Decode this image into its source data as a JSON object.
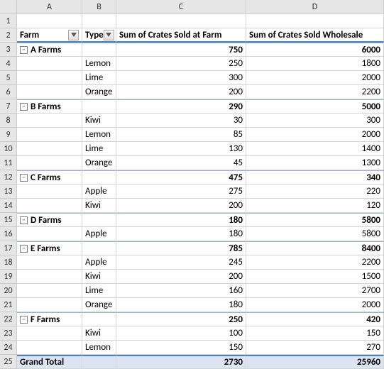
{
  "columns": [
    "A",
    "B",
    "C",
    "D"
  ],
  "headers": {
    "farm": "Farm",
    "type": "Type",
    "col_c": "Sum of Crates Sold at Farm",
    "col_d": "Sum of Crates Sold Wholesale"
  },
  "collapse_glyph": "−",
  "groups": [
    {
      "farm": "A Farms",
      "sum_c": "750",
      "sum_d": "6000",
      "rows": [
        {
          "type": "Lemon",
          "c": "250",
          "d": "1800"
        },
        {
          "type": "Lime",
          "c": "300",
          "d": "2000"
        },
        {
          "type": "Orange",
          "c": "200",
          "d": "2200"
        }
      ]
    },
    {
      "farm": "B Farms",
      "sum_c": "290",
      "sum_d": "5000",
      "rows": [
        {
          "type": "Kiwi",
          "c": "30",
          "d": "300"
        },
        {
          "type": "Lemon",
          "c": "85",
          "d": "2000"
        },
        {
          "type": "Lime",
          "c": "130",
          "d": "1400"
        },
        {
          "type": "Orange",
          "c": "45",
          "d": "1300"
        }
      ]
    },
    {
      "farm": "C Farms",
      "sum_c": "475",
      "sum_d": "340",
      "rows": [
        {
          "type": "Apple",
          "c": "275",
          "d": "220"
        },
        {
          "type": "Kiwi",
          "c": "200",
          "d": "120"
        }
      ]
    },
    {
      "farm": "D Farms",
      "sum_c": "180",
      "sum_d": "5800",
      "rows": [
        {
          "type": "Apple",
          "c": "180",
          "d": "5800"
        }
      ]
    },
    {
      "farm": "E Farms",
      "sum_c": "785",
      "sum_d": "8400",
      "rows": [
        {
          "type": "Apple",
          "c": "245",
          "d": "2200"
        },
        {
          "type": "Kiwi",
          "c": "200",
          "d": "1500"
        },
        {
          "type": "Lime",
          "c": "160",
          "d": "2700"
        },
        {
          "type": "Orange",
          "c": "180",
          "d": "2000"
        }
      ]
    },
    {
      "farm": "F Farms",
      "sum_c": "250",
      "sum_d": "420",
      "rows": [
        {
          "type": "Kiwi",
          "c": "100",
          "d": "150"
        },
        {
          "type": "Lemon",
          "c": "150",
          "d": "270"
        }
      ]
    }
  ],
  "grand_total": {
    "label": "Grand Total",
    "c": "2730",
    "d": "25960"
  }
}
